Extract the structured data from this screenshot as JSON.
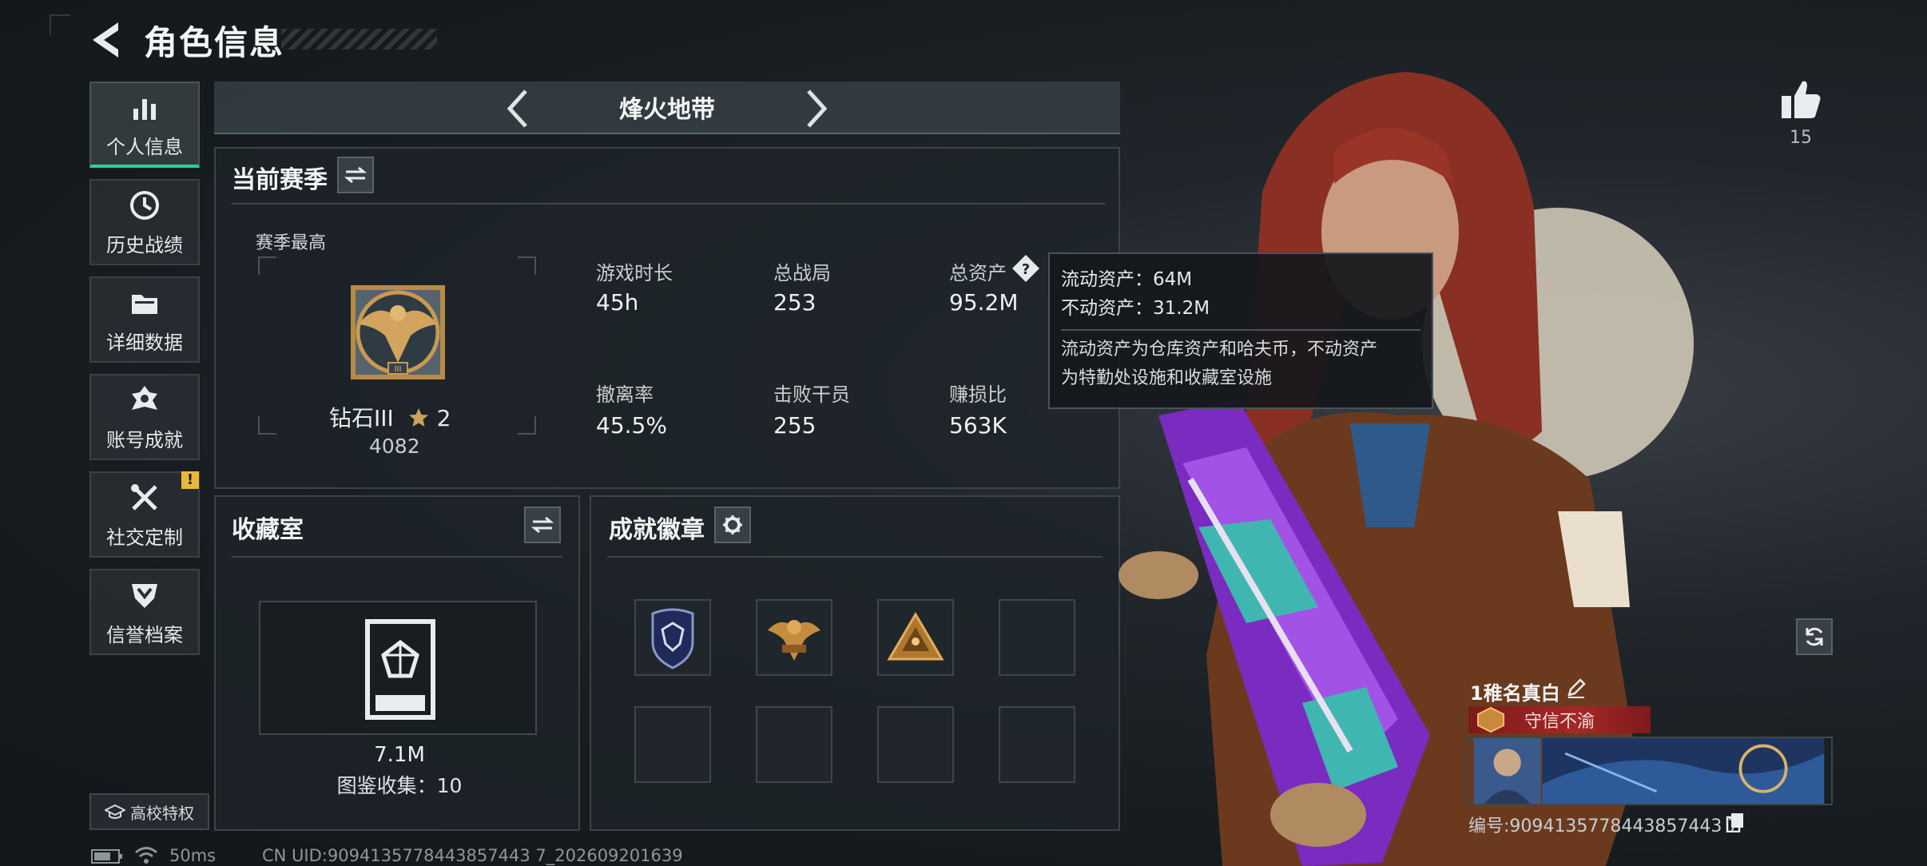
{
  "header": {
    "title": "角色信息"
  },
  "sidebar": {
    "items": [
      {
        "label": "个人信息",
        "icon": "bar-chart-icon",
        "active": true
      },
      {
        "label": "历史战绩",
        "icon": "clock-icon"
      },
      {
        "label": "详细数据",
        "icon": "folder-icon"
      },
      {
        "label": "账号成就",
        "icon": "badge-icon"
      },
      {
        "label": "社交定制",
        "icon": "tools-icon",
        "alert": "!"
      },
      {
        "label": "信誉档案",
        "icon": "shield-icon"
      }
    ],
    "campus_label": "高校特权"
  },
  "mode": {
    "name": "烽火地带"
  },
  "season": {
    "title": "当前赛季",
    "best_label": "赛季最高",
    "rank_name": "钻石III",
    "rank_stars": "2",
    "rank_score": "4082",
    "stats": [
      {
        "label": "游戏时长",
        "value": "45h"
      },
      {
        "label": "总战局",
        "value": "253"
      },
      {
        "label": "总资产",
        "value": "95.2M"
      },
      {
        "label": "撤离率",
        "value": "45.5%"
      },
      {
        "label": "击败干员",
        "value": "255"
      },
      {
        "label": "赚损比",
        "value": "563K"
      }
    ]
  },
  "tooltip": {
    "liquid": "流动资产：64M",
    "fixed": "不动资产：31.2M",
    "desc_line1": "流动资产为仓库资产和哈夫币，不动资产",
    "desc_line2": "为特勤处设施和收藏室设施"
  },
  "collection": {
    "title": "收藏室",
    "value": "7.1M",
    "count_text": "图鉴收集：10"
  },
  "badges": {
    "title": "成就徽章",
    "slots": [
      "badge-shield",
      "badge-eagle",
      "badge-pyramid",
      "",
      "",
      "",
      "",
      ""
    ]
  },
  "profile": {
    "likes": "15",
    "player_name": "1稚名真白",
    "title_badge": "守信不渝",
    "player_id": "编号:9094135778443857443 7"
  },
  "status": {
    "ping": "50ms",
    "uid": "CN UID:9094135778443857443 7_202609201639"
  },
  "colors": {
    "accent": "#28d39a",
    "alert": "#e8b83a",
    "title_badge": "#a52828"
  }
}
